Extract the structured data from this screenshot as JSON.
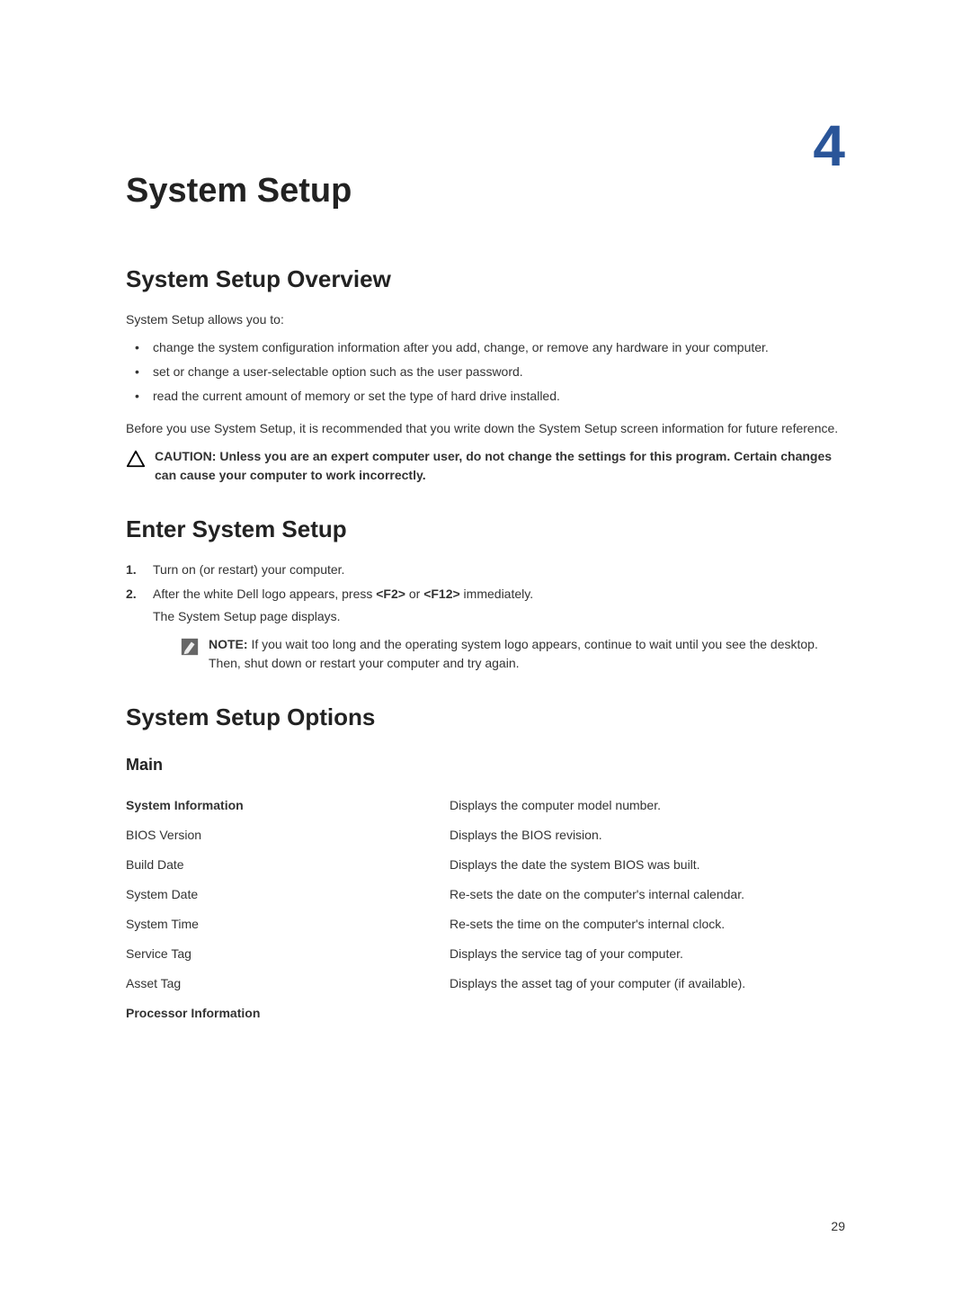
{
  "chapter_number": "4",
  "title": "System Setup",
  "section_overview": {
    "heading": "System Setup Overview",
    "intro": "System Setup allows you to:",
    "bullets": [
      "change the system configuration information after you add, change, or remove any hardware in your computer.",
      "set or change a user-selectable option such as the user password.",
      "read the current amount of memory or set the type of hard drive installed."
    ],
    "paragraph": "Before you use System Setup, it is recommended that you write down the System Setup screen information for future reference.",
    "caution_label": "CAUTION:",
    "caution_text": "Unless you are an expert computer user, do not change the settings for this program. Certain changes can cause your computer to work incorrectly."
  },
  "section_enter": {
    "heading": "Enter System Setup",
    "step1": "Turn on (or restart) your computer.",
    "step2_prefix": "After the white Dell logo appears, press ",
    "step2_key1": "<F2>",
    "step2_mid": " or ",
    "step2_key2": "<F12>",
    "step2_suffix": " immediately.",
    "step2_body": "The System Setup page displays.",
    "note_label": "NOTE:",
    "note_text": "If you wait too long and the operating system logo appears, continue to wait until you see the desktop. Then, shut down or restart your computer and try again."
  },
  "section_options": {
    "heading": "System Setup Options",
    "subheading": "Main",
    "rows": [
      {
        "label": "System Information",
        "desc": "Displays the computer model number.",
        "bold": true
      },
      {
        "label": "BIOS Version",
        "desc": "Displays the BIOS revision."
      },
      {
        "label": "Build Date",
        "desc": "Displays the date the system BIOS was built."
      },
      {
        "label": "System Date",
        "desc": "Re-sets the date on the computer's internal calendar."
      },
      {
        "label": "System Time",
        "desc": "Re-sets the time on the computer's internal clock."
      },
      {
        "label": "Service Tag",
        "desc": "Displays the service tag of your computer."
      },
      {
        "label": "Asset Tag",
        "desc": "Displays the asset tag of your computer (if available)."
      }
    ],
    "proc_info": "Processor Information"
  },
  "page_number": "29"
}
